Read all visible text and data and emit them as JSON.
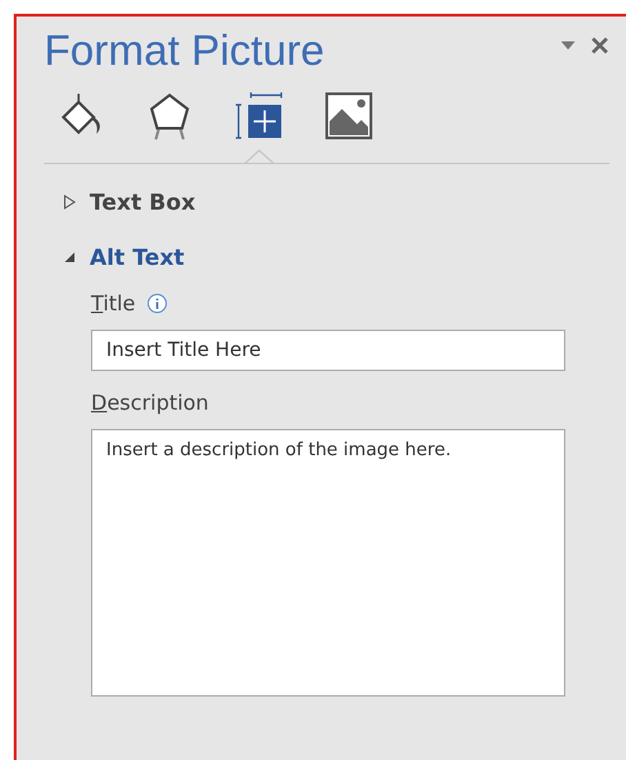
{
  "pane": {
    "title": "Format Picture"
  },
  "tabs": [
    {
      "kind": "fill",
      "selected": false
    },
    {
      "kind": "effects",
      "selected": false
    },
    {
      "kind": "layout",
      "selected": true
    },
    {
      "kind": "picture",
      "selected": false
    }
  ],
  "sections": [
    {
      "label": "Text Box",
      "expanded": false
    },
    {
      "label": "Alt Text",
      "expanded": true
    }
  ],
  "alt_text": {
    "title_label": "Title",
    "title_value": "Insert Title Here",
    "description_label": "Description",
    "description_value": "Insert a description of the image here."
  }
}
